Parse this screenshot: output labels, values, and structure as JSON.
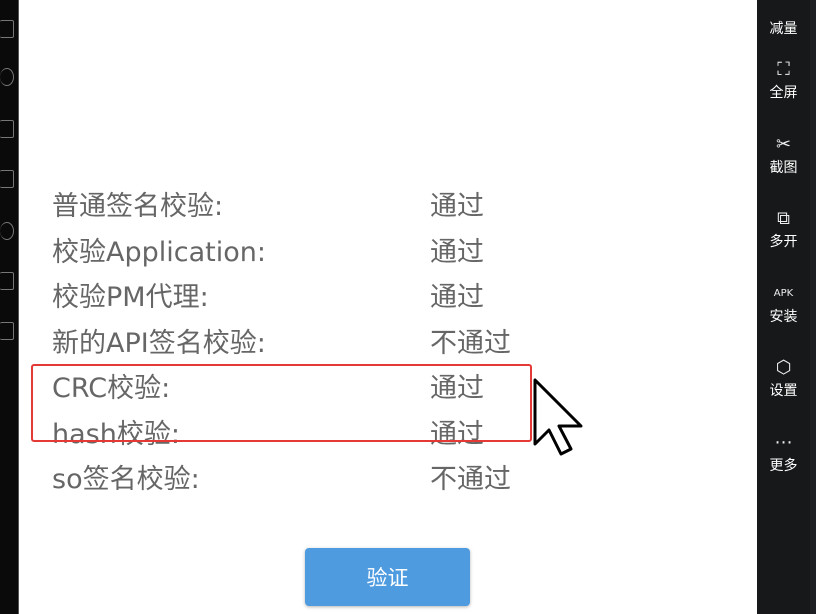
{
  "checks": [
    {
      "label": "普通签名校验:",
      "result": "通过"
    },
    {
      "label": "校验Application:",
      "result": "通过"
    },
    {
      "label": "校验PM代理:",
      "result": "通过"
    },
    {
      "label": "新的API签名校验:",
      "result": "不通过"
    },
    {
      "label": "CRC校验:",
      "result": "通过"
    },
    {
      "label": "hash校验:",
      "result": "通过"
    },
    {
      "label": "so签名校验:",
      "result": "不通过"
    }
  ],
  "verify_button": "验证",
  "highlight_color": "#e53935",
  "accent": "#4f9be0",
  "toolbar": [
    {
      "label": "减量",
      "icon": "volume-down-icon",
      "glyph": ""
    },
    {
      "label": "全屏",
      "icon": "fullscreen-icon",
      "glyph": "⛶"
    },
    {
      "label": "截图",
      "icon": "scissors-icon",
      "glyph": "✂"
    },
    {
      "label": "多开",
      "icon": "multi-window-icon",
      "glyph": "⧉"
    },
    {
      "label": "安装",
      "icon": "apk-install-icon",
      "glyph": "APK"
    },
    {
      "label": "设置",
      "icon": "settings-icon",
      "glyph": "⬡"
    },
    {
      "label": "更多",
      "icon": "more-icon",
      "glyph": "⋯"
    }
  ]
}
